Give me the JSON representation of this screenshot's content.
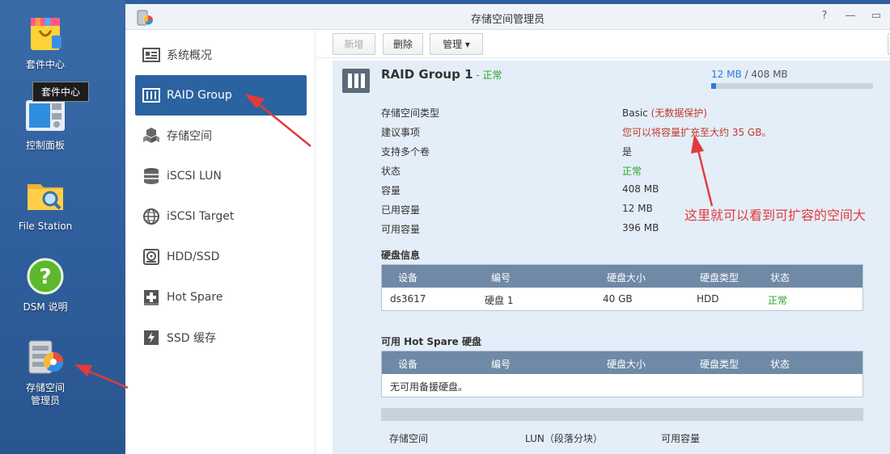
{
  "desktop": {
    "icons": [
      {
        "label": "套件中心"
      },
      {
        "label": "控制面板"
      },
      {
        "label": "File Station"
      },
      {
        "label": "DSM 说明"
      },
      {
        "label": "存储空间\n管理员"
      }
    ],
    "tooltip": "套件中心"
  },
  "window": {
    "title": "存储空间管理员",
    "controls": {
      "help": "?",
      "minimize": "—",
      "maximize": "▭"
    }
  },
  "sidebar": {
    "items": [
      {
        "label": "系统概况",
        "icon": "overview-icon"
      },
      {
        "label": "RAID Group",
        "icon": "raid-icon",
        "active": true
      },
      {
        "label": "存储空间",
        "icon": "cubes-icon"
      },
      {
        "label": "iSCSI LUN",
        "icon": "database-icon"
      },
      {
        "label": "iSCSI Target",
        "icon": "globe-icon"
      },
      {
        "label": "HDD/SSD",
        "icon": "disk-icon"
      },
      {
        "label": "Hot Spare",
        "icon": "plus-box-icon"
      },
      {
        "label": "SSD 缓存",
        "icon": "lightning-icon"
      }
    ]
  },
  "toolbar": {
    "create": "新增",
    "delete": "删除",
    "manage": "管理 ▾"
  },
  "raid": {
    "title": "RAID Group 1",
    "status_sep": " - ",
    "status": "正常",
    "used": "12 MB",
    "total_sep": " / ",
    "total": "408 MB",
    "usage_fraction": 0.03,
    "details": [
      {
        "key": "存储空间类型",
        "value": "Basic",
        "value_extra": "(无数据保护)"
      },
      {
        "key": "建议事项",
        "value": "您可以将容量扩充至大约 35 GB。"
      },
      {
        "key": "支持多个卷",
        "value": "是"
      },
      {
        "key": "状态",
        "value": "正常"
      },
      {
        "key": "容量",
        "value": "408 MB"
      },
      {
        "key": "已用容量",
        "value": "12 MB"
      },
      {
        "key": "可用容量",
        "value": "396 MB"
      }
    ]
  },
  "disks": {
    "title": "硬盘信息",
    "columns": [
      "设备",
      "编号",
      "硬盘大小",
      "硬盘类型",
      "状态"
    ],
    "rows": [
      {
        "device": "ds3617",
        "number": "硬盘 1",
        "size": "40 GB",
        "type": "HDD",
        "status": "正常"
      }
    ]
  },
  "hotspare": {
    "title": "可用 Hot Spare 硬盘",
    "columns": [
      "设备",
      "编号",
      "硬盘大小",
      "硬盘类型",
      "状态"
    ],
    "empty": "无可用备援硬盘。"
  },
  "bottom_tabs": [
    "存储空间",
    "LUN（段落分块）",
    "可用容量"
  ],
  "annotation": "这里就可以看到可扩容的空间大",
  "colors": {
    "accent": "#2b62a0",
    "ok": "#2aa12a",
    "warn": "#c0392b",
    "annotation": "#e23b3b"
  }
}
